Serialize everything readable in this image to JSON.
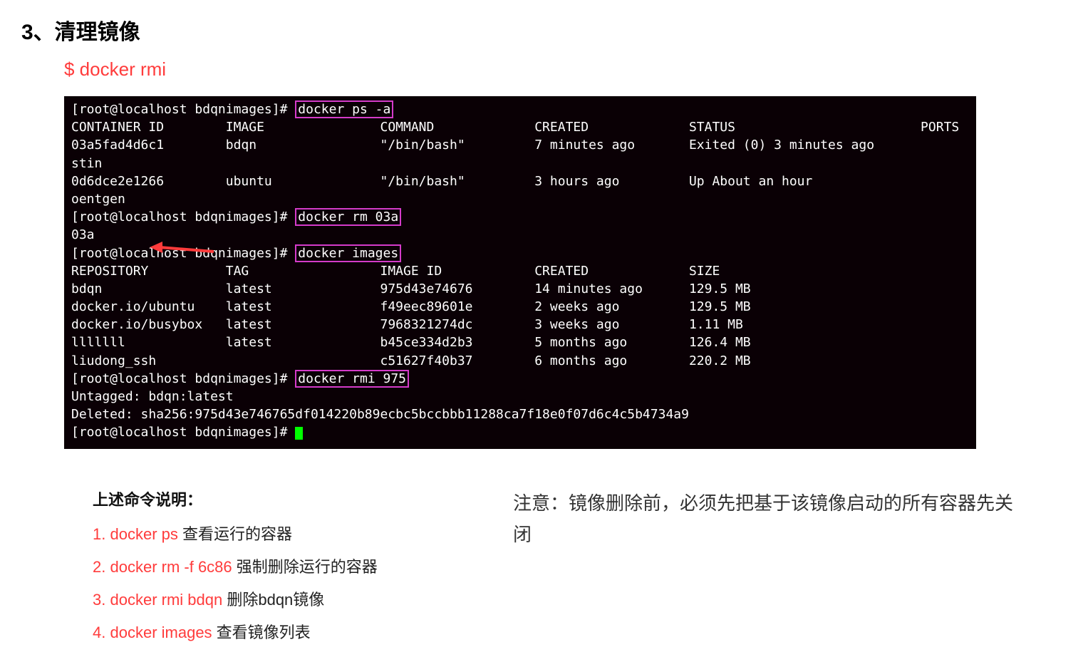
{
  "heading": "3、清理镜像",
  "cmd_title": "$ docker rmi",
  "terminal": {
    "prompt1": "[root@localhost bdqnimages]# ",
    "cmd_ps": "docker ps -a",
    "ps_header": "CONTAINER ID        IMAGE               COMMAND             CREATED             STATUS                        PORTS",
    "ps_row1a": "03a5fad4d6c1        bdqn                \"/bin/bash\"         7 minutes ago       Exited (0) 3 minutes ago",
    "ps_row1b": "stin",
    "ps_row2a": "0d6dce2e1266        ubuntu              \"/bin/bash\"         3 hours ago         Up About an hour",
    "ps_row2b": "oentgen",
    "prompt2": "[root@localhost bdqnimages]# ",
    "cmd_rm": "docker rm 03a",
    "rm_out": "03a",
    "prompt3": "[root@localhost bdqnimages]# ",
    "cmd_images": "docker images",
    "img_header": "REPOSITORY          TAG                 IMAGE ID            CREATED             SIZE",
    "img_row1": "bdqn                latest              975d43e74676        14 minutes ago      129.5 MB",
    "img_row2": "docker.io/ubuntu    latest              f49eec89601e        2 weeks ago         129.5 MB",
    "img_row3": "docker.io/busybox   latest              7968321274dc        3 weeks ago         1.11 MB",
    "img_row4": "lllllll             latest              b45ce334d2b3        5 months ago        126.4 MB",
    "img_row5": "liudong_ssh                             c51627f40b37        6 months ago        220.2 MB",
    "prompt4": "[root@localhost bdqnimages]# ",
    "cmd_rmi": "docker rmi 975",
    "rmi_out1": "Untagged: bdqn:latest",
    "rmi_out2": "Deleted: sha256:975d43e746765df014220b89ecbc5bccbbb11288ca7f18e0f07d6c4c5b4734a9",
    "prompt5": "[root@localhost bdqnimages]# "
  },
  "explain_title": "上述命令说明：",
  "explain_items": [
    {
      "num": "1.",
      "cmd": "docker ps",
      "desc": " 查看运行的容器"
    },
    {
      "num": "2.",
      "cmd": "docker rm -f 6c86",
      "desc": " 强制删除运行的容器"
    },
    {
      "num": "3.",
      "cmd": "docker rmi bdqn",
      "desc": " 删除bdqn镜像"
    },
    {
      "num": "4.",
      "cmd": "docker images",
      "desc": " 查看镜像列表"
    }
  ],
  "note": "注意：镜像删除前，必须先把基于该镜像启动的所有容器先关闭"
}
